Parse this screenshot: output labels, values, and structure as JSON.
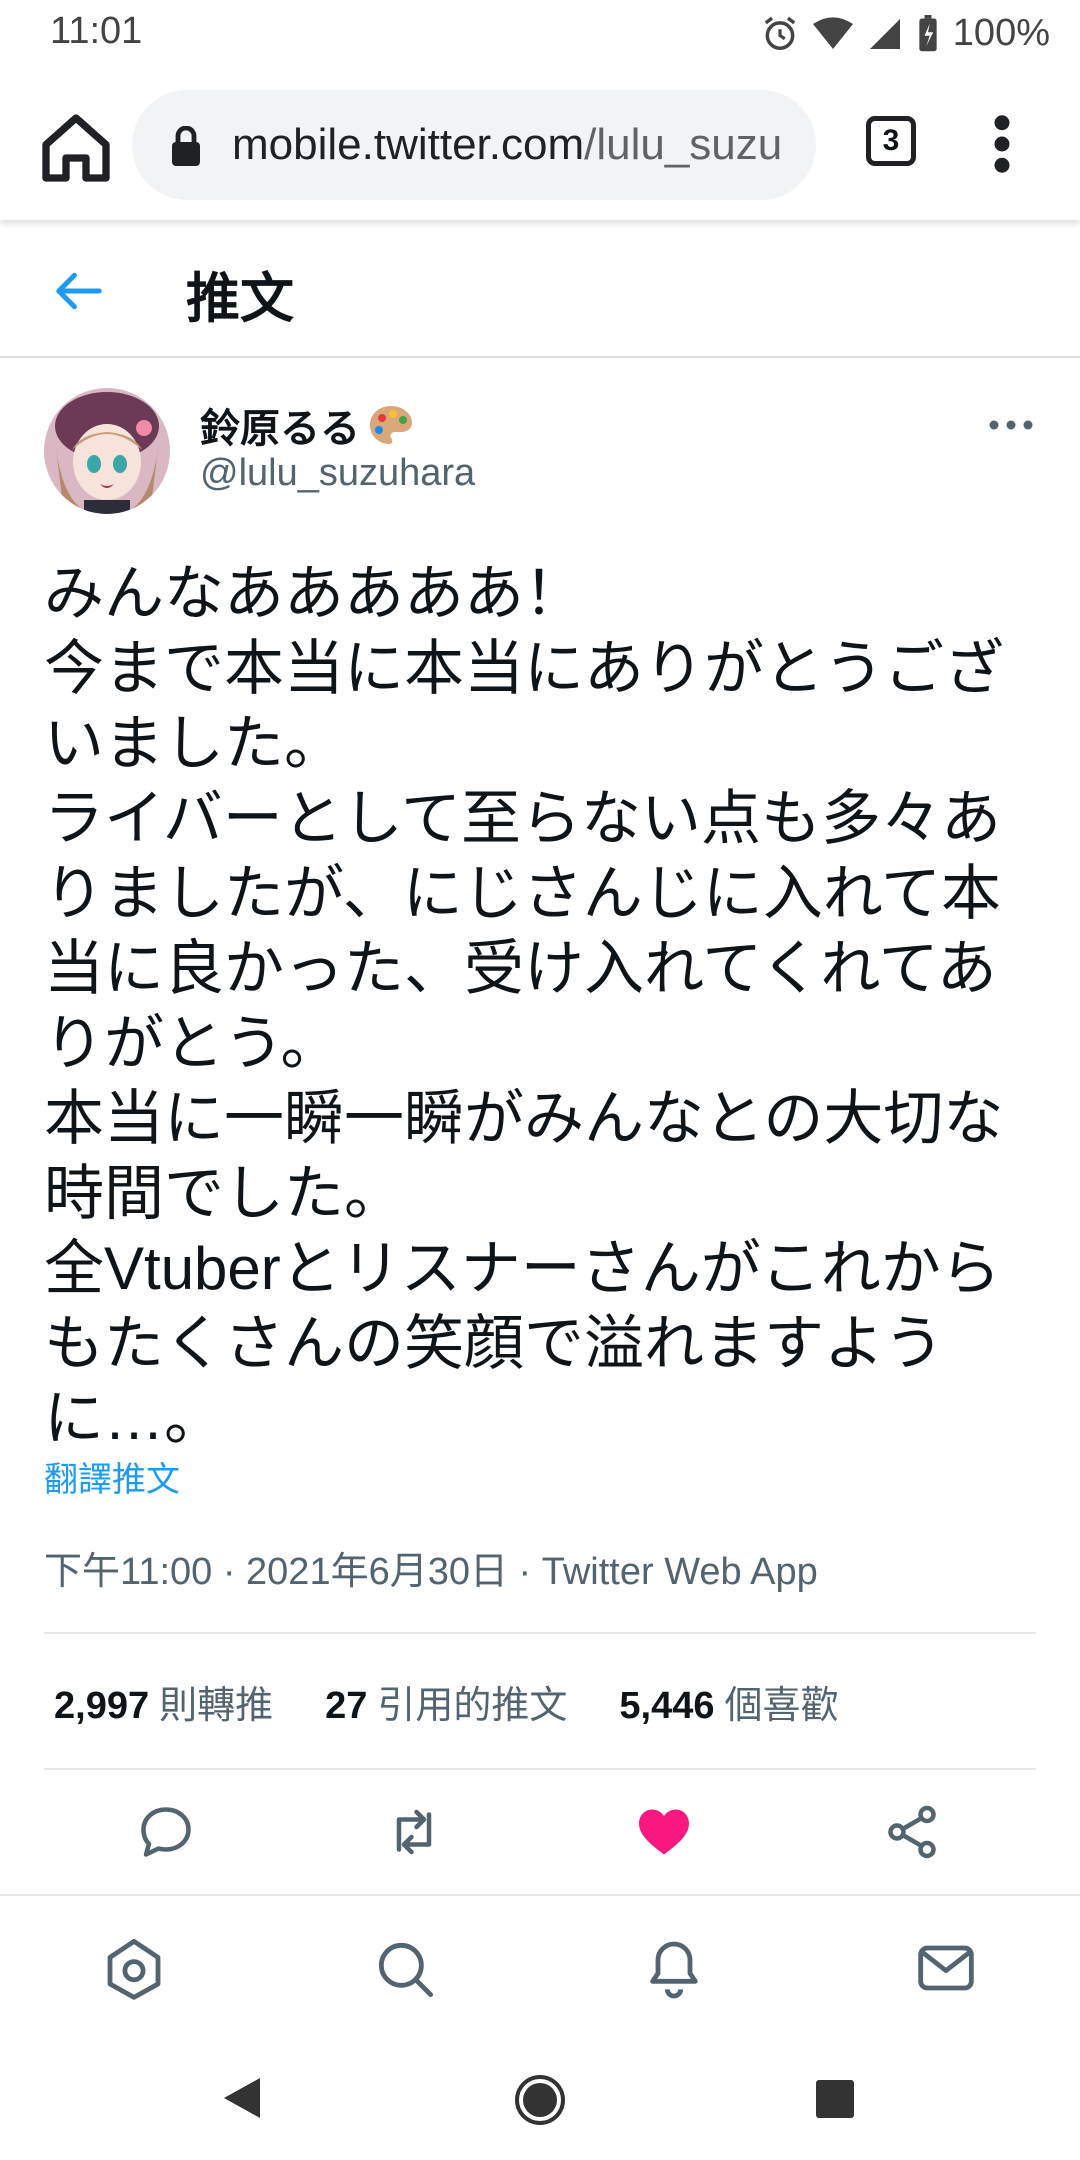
{
  "status_bar": {
    "time": "11:01",
    "battery": "100%"
  },
  "browser": {
    "url_host": "mobile.twitter.com",
    "url_path": "/lulu_suzu",
    "tab_count": "3"
  },
  "header": {
    "title": "推文"
  },
  "tweet": {
    "author_name": "鈴原るる",
    "author_handle": "@lulu_suzuhara",
    "text": "みんなあああああ！\n今まで本当に本当にありがとうござ\nいました。\nライバーとして至らない点も多々あ\nりましたが、にじさんじに入れて本\n当に良かった、受け入れてくれてあ\nりがとう。\n本当に一瞬一瞬がみんなとの大切な\n時間でした。\n全Vtuberとリスナーさんがこれから\nもたくさんの笑顔で溢れますよう\nに…。",
    "translate_label": "翻譯推文",
    "meta": "下午11:00 · 2021年6月30日 · Twitter Web App",
    "stats": {
      "retweets_count": "2,997",
      "retweets_label": "則轉推",
      "quotes_count": "27",
      "quotes_label": "引用的推文",
      "likes_count": "5,446",
      "likes_label": "個喜歡"
    }
  },
  "colors": {
    "accent": "#1d9bf0",
    "like": "#f91880",
    "secondary_text": "#536471"
  },
  "icons": [
    "home-icon",
    "lock-icon",
    "tabs-icon",
    "menu-icon",
    "back-arrow-icon",
    "more-icon",
    "reply-icon",
    "retweet-icon",
    "like-icon",
    "share-icon",
    "nav-home-icon",
    "nav-search-icon",
    "nav-notifications-icon",
    "nav-messages-icon",
    "android-back-icon",
    "android-home-icon",
    "android-recents-icon"
  ]
}
